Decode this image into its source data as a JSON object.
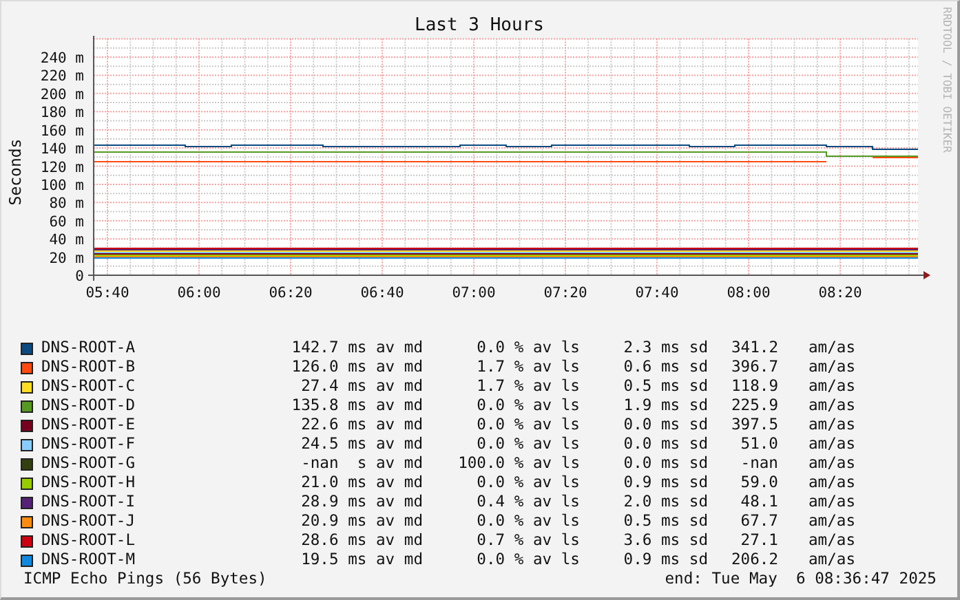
{
  "chart": {
    "credit": "RRDTOOL / TOBI OETIKER",
    "chart_data": {
      "type": "line",
      "grid": true,
      "title": "Last 3 Hours",
      "ylabel": "Seconds",
      "x": [
        337,
        347,
        357,
        367,
        377,
        387,
        397,
        407,
        417,
        427,
        437,
        447,
        457,
        467,
        477,
        487,
        497,
        507,
        517
      ],
      "xlim": [
        337,
        517
      ],
      "ylim": [
        0,
        260
      ],
      "xticks": [
        {
          "value": 340,
          "label": "05:40"
        },
        {
          "value": 360,
          "label": "06:00"
        },
        {
          "value": 380,
          "label": "06:20"
        },
        {
          "value": 400,
          "label": "06:40"
        },
        {
          "value": 420,
          "label": "07:00"
        },
        {
          "value": 440,
          "label": "07:20"
        },
        {
          "value": 460,
          "label": "07:40"
        },
        {
          "value": 480,
          "label": "08:00"
        },
        {
          "value": 500,
          "label": "08:20"
        }
      ],
      "yticks": [
        {
          "value": 0,
          "label": "0"
        },
        {
          "value": 20,
          "label": "20 m"
        },
        {
          "value": 40,
          "label": "40 m"
        },
        {
          "value": 60,
          "label": "60 m"
        },
        {
          "value": 80,
          "label": "80 m"
        },
        {
          "value": 100,
          "label": "100 m"
        },
        {
          "value": 120,
          "label": "120 m"
        },
        {
          "value": 140,
          "label": "140 m"
        },
        {
          "value": 160,
          "label": "160 m"
        },
        {
          "value": 180,
          "label": "180 m"
        },
        {
          "value": 200,
          "label": "200 m"
        },
        {
          "value": 220,
          "label": "220 m"
        },
        {
          "value": 240,
          "label": "240 m"
        }
      ],
      "series": [
        {
          "name": "DNS-ROOT-A",
          "color": "#0b4a80",
          "values": [
            144,
            144,
            143,
            144,
            144,
            143,
            143,
            143,
            144,
            143,
            144,
            144,
            144,
            143,
            144,
            144,
            143,
            139,
            139
          ]
        },
        {
          "name": "DNS-ROOT-B",
          "color": "#ff4a11",
          "values": [
            125,
            125,
            126,
            126,
            126,
            126,
            126,
            126,
            126,
            125,
            126,
            126,
            126,
            125,
            126,
            126,
            null,
            130,
            130
          ]
        },
        {
          "name": "DNS-ROOT-C",
          "color": "#ffdd22",
          "values": [
            27.5,
            27.5,
            27.5,
            27.5,
            27.5,
            27.5,
            27.5,
            27.5,
            27.5,
            27.5,
            27.5,
            27.5,
            27.5,
            27.5,
            27.5,
            27.5,
            27.5,
            27.5,
            27.5
          ]
        },
        {
          "name": "DNS-ROOT-D",
          "color": "#559922",
          "values": [
            137,
            136,
            137,
            136,
            136,
            137,
            137,
            136,
            137,
            137,
            137,
            137,
            137,
            137,
            137,
            136,
            131,
            131,
            132
          ]
        },
        {
          "name": "DNS-ROOT-E",
          "color": "#77001f",
          "values": [
            24.3,
            24.3,
            24.3,
            24.3,
            24.3,
            24.3,
            24.3,
            24.3,
            24.3,
            24.3,
            24.3,
            24.3,
            24.3,
            24.3,
            24.3,
            24.3,
            24.3,
            24.3,
            24.3
          ]
        },
        {
          "name": "DNS-ROOT-F",
          "color": "#88ccff",
          "values": [
            25.9,
            25.9,
            25.9,
            25.9,
            25.9,
            25.9,
            25.9,
            25.9,
            25.9,
            25.9,
            25.9,
            25.9,
            25.9,
            25.9,
            25.9,
            25.9,
            25.9,
            25.9,
            25.9
          ]
        },
        {
          "name": "DNS-ROOT-G",
          "color": "#333f11",
          "values": [
            null,
            null,
            null,
            null,
            null,
            null,
            null,
            null,
            null,
            null,
            null,
            null,
            null,
            null,
            null,
            null,
            null,
            null,
            null
          ]
        },
        {
          "name": "DNS-ROOT-H",
          "color": "#99cc00",
          "values": [
            22.7,
            22.7,
            22.7,
            22.7,
            22.7,
            22.7,
            22.7,
            22.7,
            22.7,
            22.7,
            22.7,
            22.7,
            22.7,
            22.7,
            22.7,
            22.7,
            22.7,
            22.7,
            22.7
          ]
        },
        {
          "name": "DNS-ROOT-I",
          "color": "#552277",
          "values": [
            29.1,
            29.1,
            29.1,
            29.1,
            29.1,
            29.1,
            29.1,
            29.1,
            29.1,
            29.1,
            29.1,
            29.1,
            29.1,
            29.1,
            29.1,
            29.1,
            29.1,
            29.1,
            29.1
          ]
        },
        {
          "name": "DNS-ROOT-J",
          "color": "#ff8c11",
          "values": [
            21.1,
            21.1,
            21.1,
            21.1,
            21.1,
            21.1,
            21.1,
            21.1,
            21.1,
            21.1,
            21.1,
            21.1,
            21.1,
            21.1,
            21.1,
            21.1,
            21.1,
            21.1,
            21.1
          ]
        },
        {
          "name": "DNS-ROOT-L",
          "color": "#cc0011",
          "values": [
            30.7,
            30.7,
            30.7,
            30.7,
            30.7,
            30.7,
            30.7,
            30.7,
            30.7,
            30.7,
            30.7,
            30.7,
            30.7,
            30.7,
            30.7,
            30.7,
            30.7,
            30.7,
            30.7
          ]
        },
        {
          "name": "DNS-ROOT-M",
          "color": "#1188dd",
          "values": [
            19.5,
            19.5,
            19.5,
            19.5,
            19.5,
            19.5,
            19.5,
            19.5,
            19.5,
            19.5,
            19.5,
            19.5,
            19.5,
            19.5,
            19.5,
            19.5,
            19.5,
            19.5,
            19.5
          ]
        }
      ]
    },
    "legend": [
      {
        "median": "142.7 ms av md",
        "loss": "0.0 % av ls",
        "sd": "2.3 ms sd",
        "ratio": "341.2",
        "ratio_unit": "am/as"
      },
      {
        "median": "126.0 ms av md",
        "loss": "1.7 % av ls",
        "sd": "0.6 ms sd",
        "ratio": "396.7",
        "ratio_unit": "am/as"
      },
      {
        "median": "27.4 ms av md",
        "loss": "1.7 % av ls",
        "sd": "0.5 ms sd",
        "ratio": "118.9",
        "ratio_unit": "am/as"
      },
      {
        "median": "135.8 ms av md",
        "loss": "0.0 % av ls",
        "sd": "1.9 ms sd",
        "ratio": "225.9",
        "ratio_unit": "am/as"
      },
      {
        "median": "22.6 ms av md",
        "loss": "0.0 % av ls",
        "sd": "0.0 ms sd",
        "ratio": "397.5",
        "ratio_unit": "am/as"
      },
      {
        "median": "24.5 ms av md",
        "loss": "0.0 % av ls",
        "sd": "0.0 ms sd",
        "ratio": "51.0",
        "ratio_unit": "am/as"
      },
      {
        "median": "-nan  s av md",
        "loss": "100.0 % av ls",
        "sd": "0.0 ms sd",
        "ratio": "-nan",
        "ratio_unit": "am/as"
      },
      {
        "median": "21.0 ms av md",
        "loss": "0.0 % av ls",
        "sd": "0.9 ms sd",
        "ratio": "59.0",
        "ratio_unit": "am/as"
      },
      {
        "median": "28.9 ms av md",
        "loss": "0.4 % av ls",
        "sd": "2.0 ms sd",
        "ratio": "48.1",
        "ratio_unit": "am/as"
      },
      {
        "median": "20.9 ms av md",
        "loss": "0.0 % av ls",
        "sd": "0.5 ms sd",
        "ratio": "67.7",
        "ratio_unit": "am/as"
      },
      {
        "median": "28.6 ms av md",
        "loss": "0.7 % av ls",
        "sd": "3.6 ms sd",
        "ratio": "27.1",
        "ratio_unit": "am/as"
      },
      {
        "median": "19.5 ms av md",
        "loss": "0.0 % av ls",
        "sd": "0.9 ms sd",
        "ratio": "206.2",
        "ratio_unit": "am/as"
      }
    ]
  },
  "footer": {
    "description": "ICMP Echo Pings (56 Bytes)",
    "end_time": "end: Tue May  6 08:36:47 2025"
  }
}
